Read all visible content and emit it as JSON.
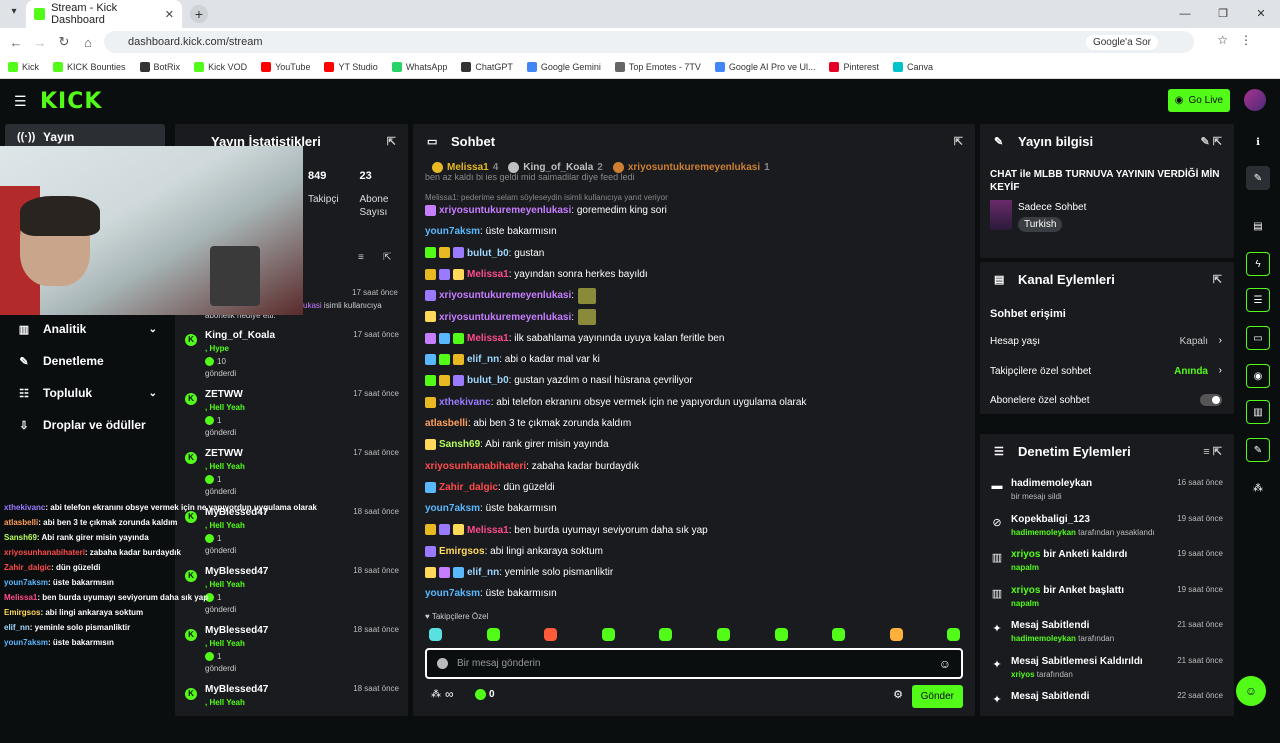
{
  "browser": {
    "tab_title": "Stream - Kick Dashboard",
    "url": "dashboard.kick.com/stream",
    "google_btn": "Google'a Sor",
    "bookmarks": [
      "Kick",
      "KICK Bounties",
      "BotRix",
      "Kick VOD",
      "YouTube",
      "YT Studio",
      "WhatsApp",
      "ChatGPT",
      "Google Gemini",
      "Top Emotes - 7TV",
      "Google AI Pro ve Ul...",
      "Pinterest",
      "Canva"
    ]
  },
  "header": {
    "logo": "KICK",
    "golive": "Go Live"
  },
  "sidebar": {
    "items": [
      {
        "label": "Yayın",
        "icon": "broadcast-icon"
      },
      {
        "label": "Analitik",
        "icon": "chart-icon"
      },
      {
        "label": "Denetleme",
        "icon": "wrench-icon"
      },
      {
        "label": "Topluluk",
        "icon": "community-icon"
      },
      {
        "label": "Droplar ve ödüller",
        "icon": "gift-icon"
      }
    ]
  },
  "overlay_chat": [
    {
      "u": "xthekivanc",
      "t": ": abi telefon ekranını obsye vermek için ne yapıyordun uygulama olarak",
      "c": "#9a7bff"
    },
    {
      "u": "atlasbelli",
      "t": ": abi ben 3 te çıkmak zorunda kaldım",
      "c": "#ff9f5a"
    },
    {
      "u": "Sansh69",
      "t": ": Abi rank girer misin yayında",
      "c": "#b8ff5a"
    },
    {
      "u": "xriyosunhanabihateri",
      "t": ": zabaha kadar burdaydık",
      "c": "#ff4b4b"
    },
    {
      "u": "Zahir_dalgic",
      "t": ": dün güzeldi",
      "c": "#ff4b4b"
    },
    {
      "u": "youn7aksm",
      "t": ": üste bakarmısın",
      "c": "#5ab8ff"
    },
    {
      "u": "Melissa1",
      "t": ": ben burda uyumayı seviyorum daha sık yap",
      "c": "#ff4b8a"
    },
    {
      "u": "Emirgsos",
      "t": ": abi lingi ankaraya soktum",
      "c": "#ffd95a"
    },
    {
      "u": "elif_nn",
      "t": ": yeminle solo pismanliktir",
      "c": "#9fd8ff"
    },
    {
      "u": "youn7aksm",
      "t": ": üste bakarmısın",
      "c": "#5ab8ff"
    }
  ],
  "stats": {
    "title": "Yayın İstatistikleri",
    "followers": "849",
    "followers_label": "Takipçi",
    "subs": "23",
    "subs_label": "Abone Sayısı"
  },
  "events": {
    "partial_top": "17 saat önce",
    "partial_name": "ukasi",
    "partial_text": " isimli kullanıcıya",
    "partial_line2": "abonelik hediye etti.",
    "items": [
      {
        "name": "King_of_Koala",
        "kind": ", Hype",
        "amount": "10",
        "sent": "gönderdi",
        "time": "17 saat önce"
      },
      {
        "name": "ZETWW",
        "kind": ", Hell Yeah",
        "amount": "1",
        "sent": "gönderdi",
        "time": "17 saat önce"
      },
      {
        "name": "ZETWW",
        "kind": ", Hell Yeah",
        "amount": "1",
        "sent": "gönderdi",
        "time": "17 saat önce"
      },
      {
        "name": "MyBlessed47",
        "kind": ", Hell Yeah",
        "amount": "1",
        "sent": "gönderdi",
        "time": "18 saat önce"
      },
      {
        "name": "MyBlessed47",
        "kind": ", Hell Yeah",
        "amount": "1",
        "sent": "gönderdi",
        "time": "18 saat önce"
      },
      {
        "name": "MyBlessed47",
        "kind": ", Hell Yeah",
        "amount": "1",
        "sent": "gönderdi",
        "time": "18 saat önce"
      },
      {
        "name": "MyBlessed47",
        "kind": ", Hell Yeah",
        "amount": "",
        "sent": "",
        "time": "18 saat önce"
      }
    ]
  },
  "chat": {
    "title": "Sohbet",
    "top": [
      {
        "name": "Melissa1",
        "n": "4",
        "c": "#e8b923"
      },
      {
        "name": "King_of_Koala",
        "n": "2",
        "c": "#c0c0c0"
      },
      {
        "name": "xriyosuntukuremeyenlukasi",
        "n": "1",
        "c": "#cd7f32"
      }
    ],
    "partial": "ben az kaldı bi ies geldi mid saimadilar diye feed ledi",
    "reply": "Melissa1: pederime selam söyleseydin isimli kullanıcıya yanıt veriyor",
    "messages": [
      {
        "u": "xriyosuntukuremeyenlukasi",
        "t": ": goremedim king sori",
        "c": "#c77dff"
      },
      {
        "u": "youn7aksm",
        "t": ": üste bakarmısın",
        "c": "#5ab8ff"
      },
      {
        "u": "bulut_b0",
        "t": ": gustan",
        "c": "#9fd8ff"
      },
      {
        "u": "Melissa1",
        "t": ": yayından sonra herkes bayıldı",
        "c": "#ff4b8a"
      },
      {
        "u": "xriyosuntukuremeyenlukasi",
        "t": ":",
        "c": "#c77dff"
      },
      {
        "u": "xriyosuntukuremeyenlukasi",
        "t": ":",
        "c": "#c77dff"
      },
      {
        "u": "Melissa1",
        "t": ": ilk sabahlama yayınında uyuya kalan feritle ben",
        "c": "#ff4b8a"
      },
      {
        "u": "elif_nn",
        "t": ": abi o kadar mal var ki",
        "c": "#9fd8ff"
      },
      {
        "u": "bulut_b0",
        "t": ": gustan yazdım o nasıl hüsrana çevriliyor",
        "c": "#9fd8ff"
      },
      {
        "u": "xthekivanc",
        "t": ": abi telefon ekranını obsye vermek için ne yapıyordun uygulama olarak",
        "c": "#9a7bff"
      },
      {
        "u": "atlasbelli",
        "t": ": abi ben 3 te çıkmak zorunda kaldım",
        "c": "#ff9f5a"
      },
      {
        "u": "Sansh69",
        "t": ": Abi rank girer misin yayında",
        "c": "#b8ff5a"
      },
      {
        "u": "xriyosunhanabihateri",
        "t": ": zabaha kadar burdaydık",
        "c": "#ff4b4b"
      },
      {
        "u": "Zahir_dalgic",
        "t": ": dün güzeldi",
        "c": "#ff4b4b"
      },
      {
        "u": "youn7aksm",
        "t": ": üste bakarmısın",
        "c": "#5ab8ff"
      },
      {
        "u": "Melissa1",
        "t": ": ben burda uyumayı seviyorum daha sık yap",
        "c": "#ff4b8a"
      },
      {
        "u": "Emirgsos",
        "t": ": abi lingi ankaraya soktum",
        "c": "#ffd95a"
      },
      {
        "u": "elif_nn",
        "t": ": yeminle solo pismanliktir",
        "c": "#9fd8ff"
      },
      {
        "u": "youn7aksm",
        "t": ": üste bakarmısın",
        "c": "#5ab8ff"
      }
    ],
    "followers_only": "Takipçilere Özel",
    "placeholder": "Bir mesaj gönderin",
    "infinity": "∞",
    "points": "0",
    "send": "Gönder"
  },
  "stream_info": {
    "title": "Yayın bilgisi",
    "stream_title": "CHAT ile MLBB TURNUVA YAYININ VERDİĞİ MİN KEYİF",
    "category": "Sadece Sohbet",
    "language": "Turkish"
  },
  "channel_actions": {
    "title": "Kanal Eylemleri",
    "section": "Sohbet erişimi",
    "rows": [
      {
        "label": "Hesap yaşı",
        "value": "Kapalı"
      },
      {
        "label": "Takipçilere özel sohbet",
        "value": "Anında"
      },
      {
        "label": "Abonelere özel sohbet",
        "value": ""
      }
    ]
  },
  "mod_actions": {
    "title": "Denetim Eylemleri",
    "items": [
      {
        "t1": "hadimemoleykan",
        "t2": "",
        "sub": "bir mesajı sildi",
        "subg": "",
        "time": "16 saat önce",
        "icon": "trash-icon"
      },
      {
        "t1": "Kopekbaligi_123",
        "t2": "",
        "sub": " tarafından yasaklandı",
        "subg": "hadimemoleykan",
        "time": "19 saat önce",
        "icon": "ban-icon"
      },
      {
        "t1": "xriyos",
        "t2": " bir Anketi kaldırdı",
        "sub": "",
        "subg": "napalm",
        "time": "19 saat önce",
        "icon": "poll-icon"
      },
      {
        "t1": "xriyos",
        "t2": " bir Anket başlattı",
        "sub": "",
        "subg": "napalm",
        "time": "19 saat önce",
        "icon": "poll-icon"
      },
      {
        "t1": "Mesaj Sabitlendi",
        "t2": "",
        "sub": " tarafından",
        "subg": "hadimemoleykan",
        "time": "21 saat önce",
        "icon": "pin-icon"
      },
      {
        "t1": "Mesaj Sabitlemesi Kaldırıldı",
        "t2": "",
        "sub": " tarafından",
        "subg": "xriyos",
        "time": "21 saat önce",
        "icon": "unpin-icon"
      },
      {
        "t1": "Mesaj Sabitlendi",
        "t2": "",
        "sub": "",
        "subg": "",
        "time": "22 saat önce",
        "icon": "pin-icon"
      }
    ]
  }
}
